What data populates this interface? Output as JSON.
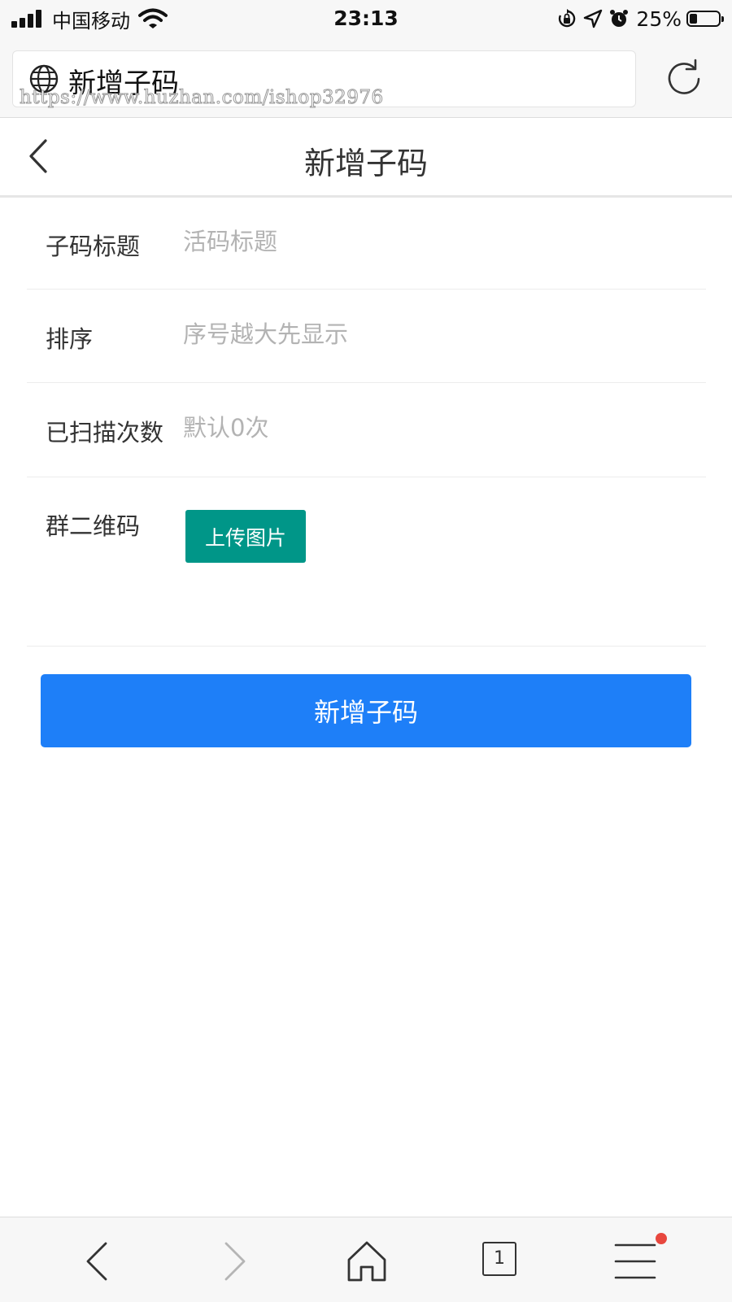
{
  "status_bar": {
    "carrier": "中国移动",
    "time": "23:13",
    "battery_percent": "25%",
    "battery_level": 0.25
  },
  "browser": {
    "address_title": "新增子码",
    "watermark": "https://www.huzhan.com/ishop32976"
  },
  "header": {
    "title": "新增子码"
  },
  "form": {
    "fields": [
      {
        "label": "子码标题",
        "placeholder": "活码标题",
        "value": ""
      },
      {
        "label": "排序",
        "placeholder": "序号越大先显示",
        "value": ""
      },
      {
        "label": "已扫描次数",
        "placeholder": "默认0次",
        "value": ""
      }
    ],
    "qr": {
      "label": "群二维码",
      "upload_label": "上传图片"
    },
    "submit_label": "新增子码"
  },
  "bottom_bar": {
    "tab_count": "1",
    "has_notification": true
  },
  "colors": {
    "upload_button": "#009688",
    "submit_button": "#1e7ff8",
    "notification_dot": "#e8473e"
  }
}
